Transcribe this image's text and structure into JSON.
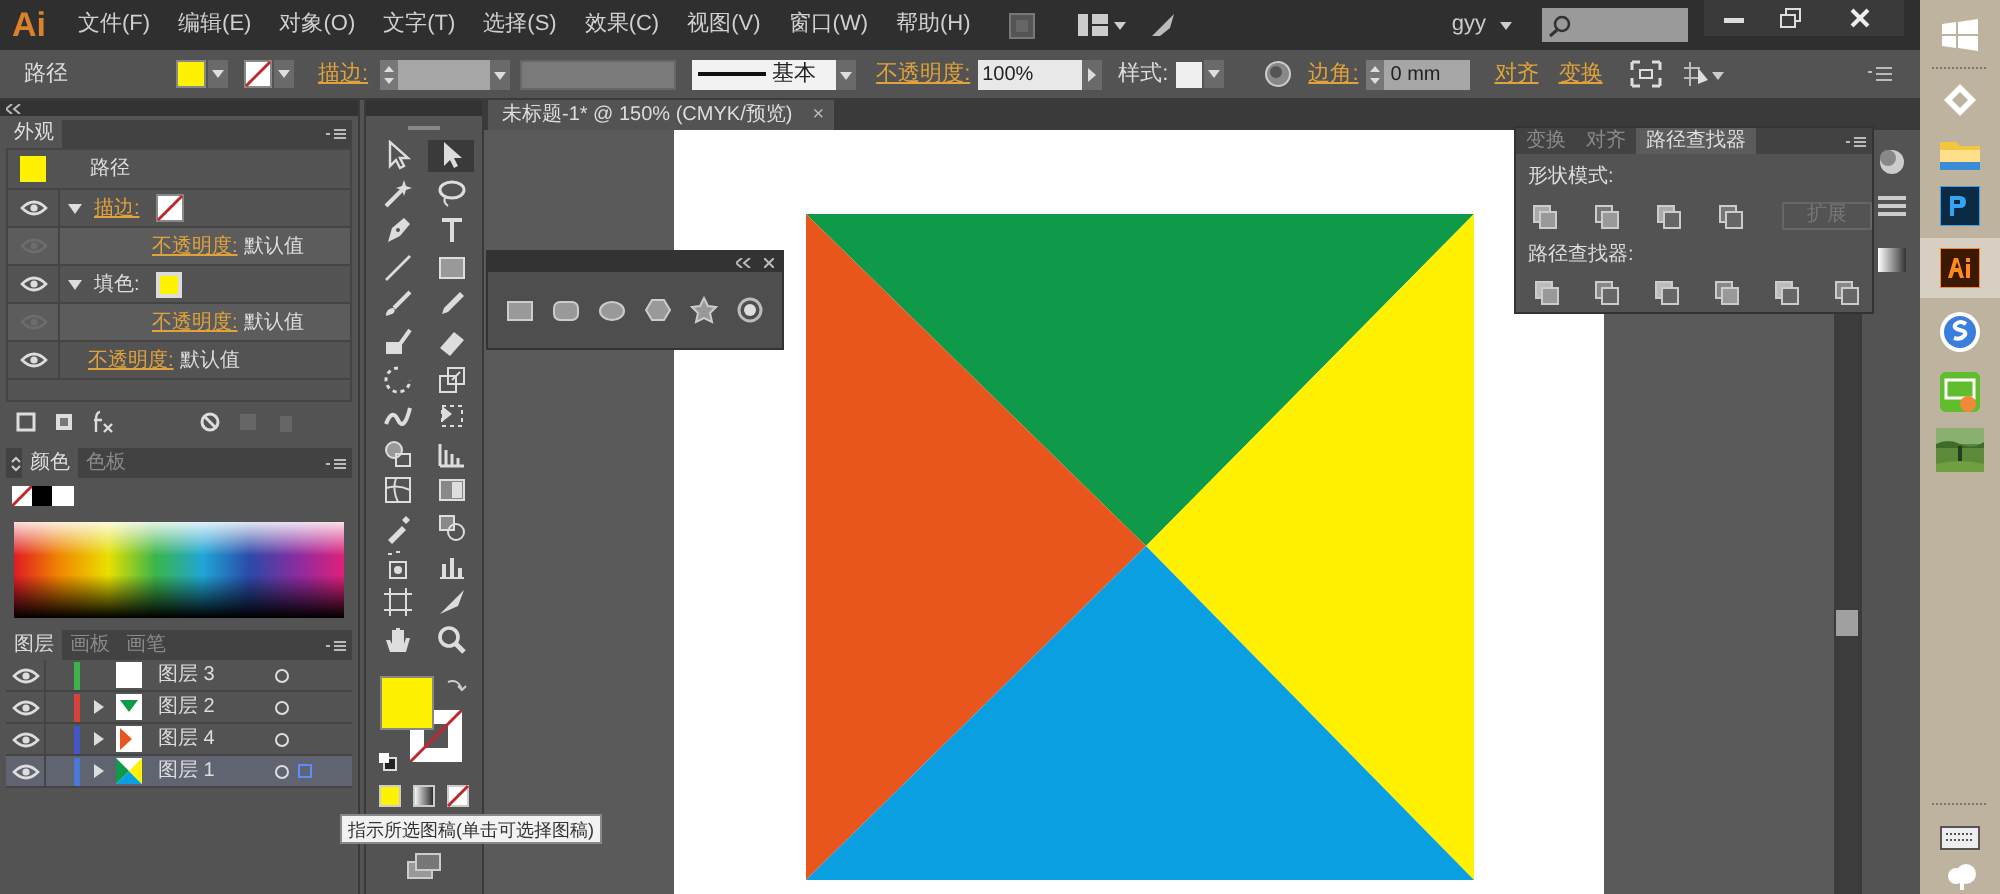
{
  "app": {
    "logo": "Ai",
    "menu": [
      "文件(F)",
      "编辑(E)",
      "对象(O)",
      "文字(T)",
      "选择(S)",
      "效果(C)",
      "视图(V)",
      "窗口(W)",
      "帮助(H)"
    ],
    "user": "gyy"
  },
  "control_bar": {
    "object_type": "路径",
    "stroke_label": "描边:",
    "stroke_style": "基本",
    "opacity_label": "不透明度:",
    "opacity": "100%",
    "style_label": "样式:",
    "corner_label": "边角:",
    "corner": "0 mm",
    "align": "对齐",
    "transform": "变换"
  },
  "appearance": {
    "title": "外观",
    "object": "路径",
    "rows": [
      {
        "kind": "stroke",
        "label": "描边:",
        "expanded": true,
        "children": [
          {
            "label": "不透明度:",
            "value": "默认值"
          }
        ]
      },
      {
        "kind": "fill",
        "label": "填色:",
        "color": "#fff200",
        "expanded": true,
        "children": [
          {
            "label": "不透明度:",
            "value": "默认值"
          }
        ]
      },
      {
        "kind": "opacity",
        "label": "不透明度:",
        "value": "默认值"
      }
    ]
  },
  "color_panel": {
    "tabs": [
      {
        "label": "颜色",
        "selected": true
      },
      {
        "label": "色板",
        "selected": false
      }
    ]
  },
  "layers_panel": {
    "tabs": [
      {
        "label": "图层",
        "selected": true
      },
      {
        "label": "画板",
        "selected": false
      },
      {
        "label": "画笔",
        "selected": false
      }
    ],
    "layers": [
      {
        "name": "图层 3",
        "color": "#3cb44a",
        "expandable": false,
        "selected": false,
        "kind": "blank"
      },
      {
        "name": "图层 2",
        "color": "#d9413a",
        "expandable": true,
        "selected": false,
        "kind": "down"
      },
      {
        "name": "图层 4",
        "color": "#4256c8",
        "expandable": true,
        "selected": false,
        "kind": "left"
      },
      {
        "name": "图层 1",
        "color": "#4a78d8",
        "expandable": true,
        "selected": true,
        "kind": "mixed"
      }
    ]
  },
  "tools": [
    {
      "selected": false
    },
    {
      "selected": true
    },
    {
      "selected": false
    },
    {
      "selected": false
    },
    {
      "selected": false
    },
    {
      "selected": false
    },
    {
      "selected": false
    },
    {
      "selected": false
    },
    {
      "selected": false
    },
    {
      "selected": false
    },
    {
      "selected": false
    },
    {
      "selected": false
    },
    {
      "selected": false
    },
    {
      "selected": false
    },
    {
      "selected": false
    },
    {
      "selected": false
    },
    {
      "selected": false
    },
    {
      "selected": false
    },
    {
      "selected": false
    },
    {
      "selected": false
    },
    {
      "selected": false
    },
    {
      "selected": false
    },
    {
      "selected": false
    },
    {
      "selected": false
    },
    {
      "selected": false
    },
    {
      "selected": false
    },
    {
      "selected": false
    },
    {
      "selected": false
    }
  ],
  "document": {
    "tab": "未标题-1* @ 150% (CMYK/预览)",
    "close": "×"
  },
  "artwork": {
    "triangles": [
      {
        "kind": "top",
        "color": "#0e9a48"
      },
      {
        "kind": "left",
        "color": "#e8561e"
      },
      {
        "kind": "right",
        "color": "#fff100"
      },
      {
        "kind": "bottom",
        "color": "#0a9fe0"
      }
    ]
  },
  "pathfinder": {
    "tabs": [
      {
        "label": "变换",
        "selected": false
      },
      {
        "label": "对齐",
        "selected": false
      },
      {
        "label": "路径查找器",
        "selected": true
      }
    ],
    "shape_modes": "形状模式:",
    "expand": {
      "label": "扩展",
      "disabled": true
    },
    "pathfinders": "路径查找器:"
  },
  "tooltip": "指示所选图稿(单击可选择图稿)"
}
